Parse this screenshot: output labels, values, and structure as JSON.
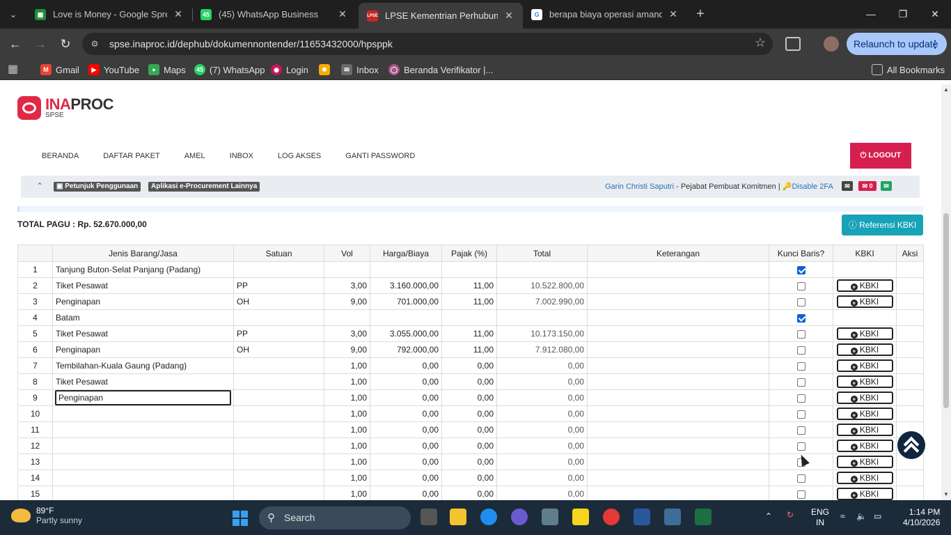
{
  "tabs": [
    {
      "title": "Love is Money - Google Spread",
      "favicon": "G-Sheets",
      "color": "#1e8e3e"
    },
    {
      "title": "(45) WhatsApp Business",
      "favicon": "45",
      "color": "#25d366"
    },
    {
      "title": "LPSE Kementrian Perhubungan",
      "favicon": "LPSE",
      "color": "#c62828"
    },
    {
      "title": "berapa biaya operasi amandel -",
      "favicon": "G",
      "color": "#4285f4"
    }
  ],
  "address": {
    "url": "spse.inaproc.id/dephub/dokumennontender/11653432000/hpsppk"
  },
  "relaunch_label": "Relaunch to update",
  "bookmarks": [
    {
      "label": "Gmail",
      "color": "#ea4335"
    },
    {
      "label": "YouTube",
      "color": "#ff0000"
    },
    {
      "label": "Maps",
      "color": "#34a853"
    },
    {
      "label": "(7) WhatsApp",
      "color": "#25d366"
    },
    {
      "label": "Login",
      "color": "#c2185b"
    },
    {
      "label": "",
      "color": "#f9ab00"
    },
    {
      "label": "Inbox",
      "color": "#6b6b6b"
    },
    {
      "label": "Beranda Verifikator |...",
      "color": "#a8548a"
    }
  ],
  "all_bookmarks": "All Bookmarks",
  "logo": {
    "main_a": "INA",
    "main_b": "PROC",
    "sub": "SPSE"
  },
  "nav": [
    "BERANDA",
    "DAFTAR PAKET",
    "AMEL",
    "INBOX",
    "LOG AKSES",
    "GANTI PASSWORD"
  ],
  "logout": "⏻ LOGOUT",
  "infobar": {
    "guide": "Petunjuk Penggunaan",
    "other_apps": "Aplikasi e-Procurement Lainnya",
    "user_name": "Garin Christi Saputri",
    "user_role": " - Pejabat Pembuat Komitmen | ",
    "disable_2fa": "Disable 2FA",
    "mail_count": "0"
  },
  "total_pagu": "TOTAL PAGU : Rp. 52.670.000,00",
  "ref_kbki": "Referensi KBKI",
  "table": {
    "headers": [
      "",
      "Jenis Barang/Jasa",
      "Satuan",
      "Vol",
      "Harga/Biaya",
      "Pajak (%)",
      "Total",
      "Keterangan",
      "Kunci Baris?",
      "KBKI",
      "Aksi"
    ],
    "kbki_label": "KBKI",
    "rows": [
      {
        "no": "1",
        "jenis": "Tanjung Buton-Selat Panjang (Padang)",
        "satuan": "",
        "vol": "",
        "harga": "",
        "pajak": "",
        "total": "",
        "kunci": true,
        "kbki": false
      },
      {
        "no": "2",
        "jenis": "Tiket Pesawat",
        "satuan": "PP",
        "vol": "3,00",
        "harga": "3.160.000,00",
        "pajak": "11,00",
        "total": "10.522.800,00",
        "kunci": false,
        "kbki": true
      },
      {
        "no": "3",
        "jenis": "Penginapan",
        "satuan": "OH",
        "vol": "9,00",
        "harga": "701.000,00",
        "pajak": "11,00",
        "total": "7.002.990,00",
        "kunci": false,
        "kbki": true
      },
      {
        "no": "4",
        "jenis": "Batam",
        "satuan": "",
        "vol": "",
        "harga": "",
        "pajak": "",
        "total": "",
        "kunci": true,
        "kbki": false
      },
      {
        "no": "5",
        "jenis": "Tiket Pesawat",
        "satuan": "PP",
        "vol": "3,00",
        "harga": "3.055.000,00",
        "pajak": "11,00",
        "total": "10.173.150,00",
        "kunci": false,
        "kbki": true
      },
      {
        "no": "6",
        "jenis": "Penginapan",
        "satuan": "OH",
        "vol": "9,00",
        "harga": "792.000,00",
        "pajak": "11,00",
        "total": "7.912.080,00",
        "kunci": false,
        "kbki": true
      },
      {
        "no": "7",
        "jenis": "Tembilahan-Kuala Gaung (Padang)",
        "satuan": "",
        "vol": "1,00",
        "harga": "0,00",
        "pajak": "0,00",
        "total": "0,00",
        "kunci": false,
        "kbki": true
      },
      {
        "no": "8",
        "jenis": "Tiket Pesawat",
        "satuan": "",
        "vol": "1,00",
        "harga": "0,00",
        "pajak": "0,00",
        "total": "0,00",
        "kunci": false,
        "kbki": true
      },
      {
        "no": "9",
        "jenis": "Penginapan",
        "satuan": "",
        "vol": "1,00",
        "harga": "0,00",
        "pajak": "0,00",
        "total": "0,00",
        "kunci": false,
        "kbki": true,
        "editing": true
      },
      {
        "no": "10",
        "jenis": "",
        "satuan": "",
        "vol": "1,00",
        "harga": "0,00",
        "pajak": "0,00",
        "total": "0,00",
        "kunci": false,
        "kbki": true
      },
      {
        "no": "11",
        "jenis": "",
        "satuan": "",
        "vol": "1,00",
        "harga": "0,00",
        "pajak": "0,00",
        "total": "0,00",
        "kunci": false,
        "kbki": true
      },
      {
        "no": "12",
        "jenis": "",
        "satuan": "",
        "vol": "1,00",
        "harga": "0,00",
        "pajak": "0,00",
        "total": "0,00",
        "kunci": false,
        "kbki": true
      },
      {
        "no": "13",
        "jenis": "",
        "satuan": "",
        "vol": "1,00",
        "harga": "0,00",
        "pajak": "0,00",
        "total": "0,00",
        "kunci": false,
        "kbki": true
      },
      {
        "no": "14",
        "jenis": "",
        "satuan": "",
        "vol": "1,00",
        "harga": "0,00",
        "pajak": "0,00",
        "total": "0,00",
        "kunci": false,
        "kbki": true
      },
      {
        "no": "15",
        "jenis": "",
        "satuan": "",
        "vol": "1,00",
        "harga": "0,00",
        "pajak": "0,00",
        "total": "0,00",
        "kunci": false,
        "kbki": true
      }
    ]
  },
  "taskbar": {
    "temp": "89°F",
    "weather": "Partly sunny",
    "search": "Search",
    "lang1": "ENG",
    "lang2": "IN",
    "time": "1:14 PM",
    "date": "4/10/2026"
  }
}
